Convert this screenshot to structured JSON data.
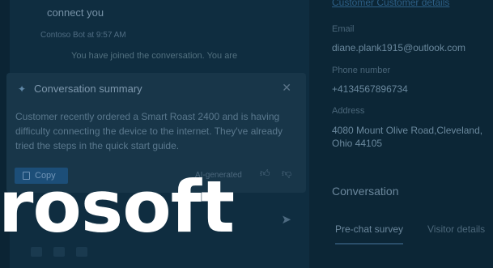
{
  "chat": {
    "line1": "connect you",
    "line2": "Contoso Bot at 9:57 AM",
    "line3": "You have joined the conversation. You are"
  },
  "summary": {
    "title": "Conversation summary",
    "body": "Customer recently ordered a Smart Roast 2400 and is having difficulty connecting the device to the internet.  They've already tried the steps in the quick start guide.",
    "copy_label": "Copy",
    "ai_label": "AI-generated"
  },
  "details": {
    "link": "Customer Customer details",
    "email_label": "Email",
    "email_value": "diane.plank1915@outlook.com",
    "phone_label": "Phone number",
    "phone_value": "+4134567896734",
    "address_label": "Address",
    "address_value": "4080 Mount Olive Road,Cleveland, Ohio 44105",
    "section_title": "Conversation",
    "tabs": [
      "Pre-chat survey",
      "Visitor details"
    ]
  },
  "overlay": {
    "text": "rosoft"
  },
  "icons": {
    "summary": "sparkle-icon",
    "close": "close-icon",
    "copy": "copy-icon",
    "thumbs_up": "thumbs-up-icon",
    "thumbs_down": "thumbs-down-icon",
    "send": "send-icon"
  }
}
